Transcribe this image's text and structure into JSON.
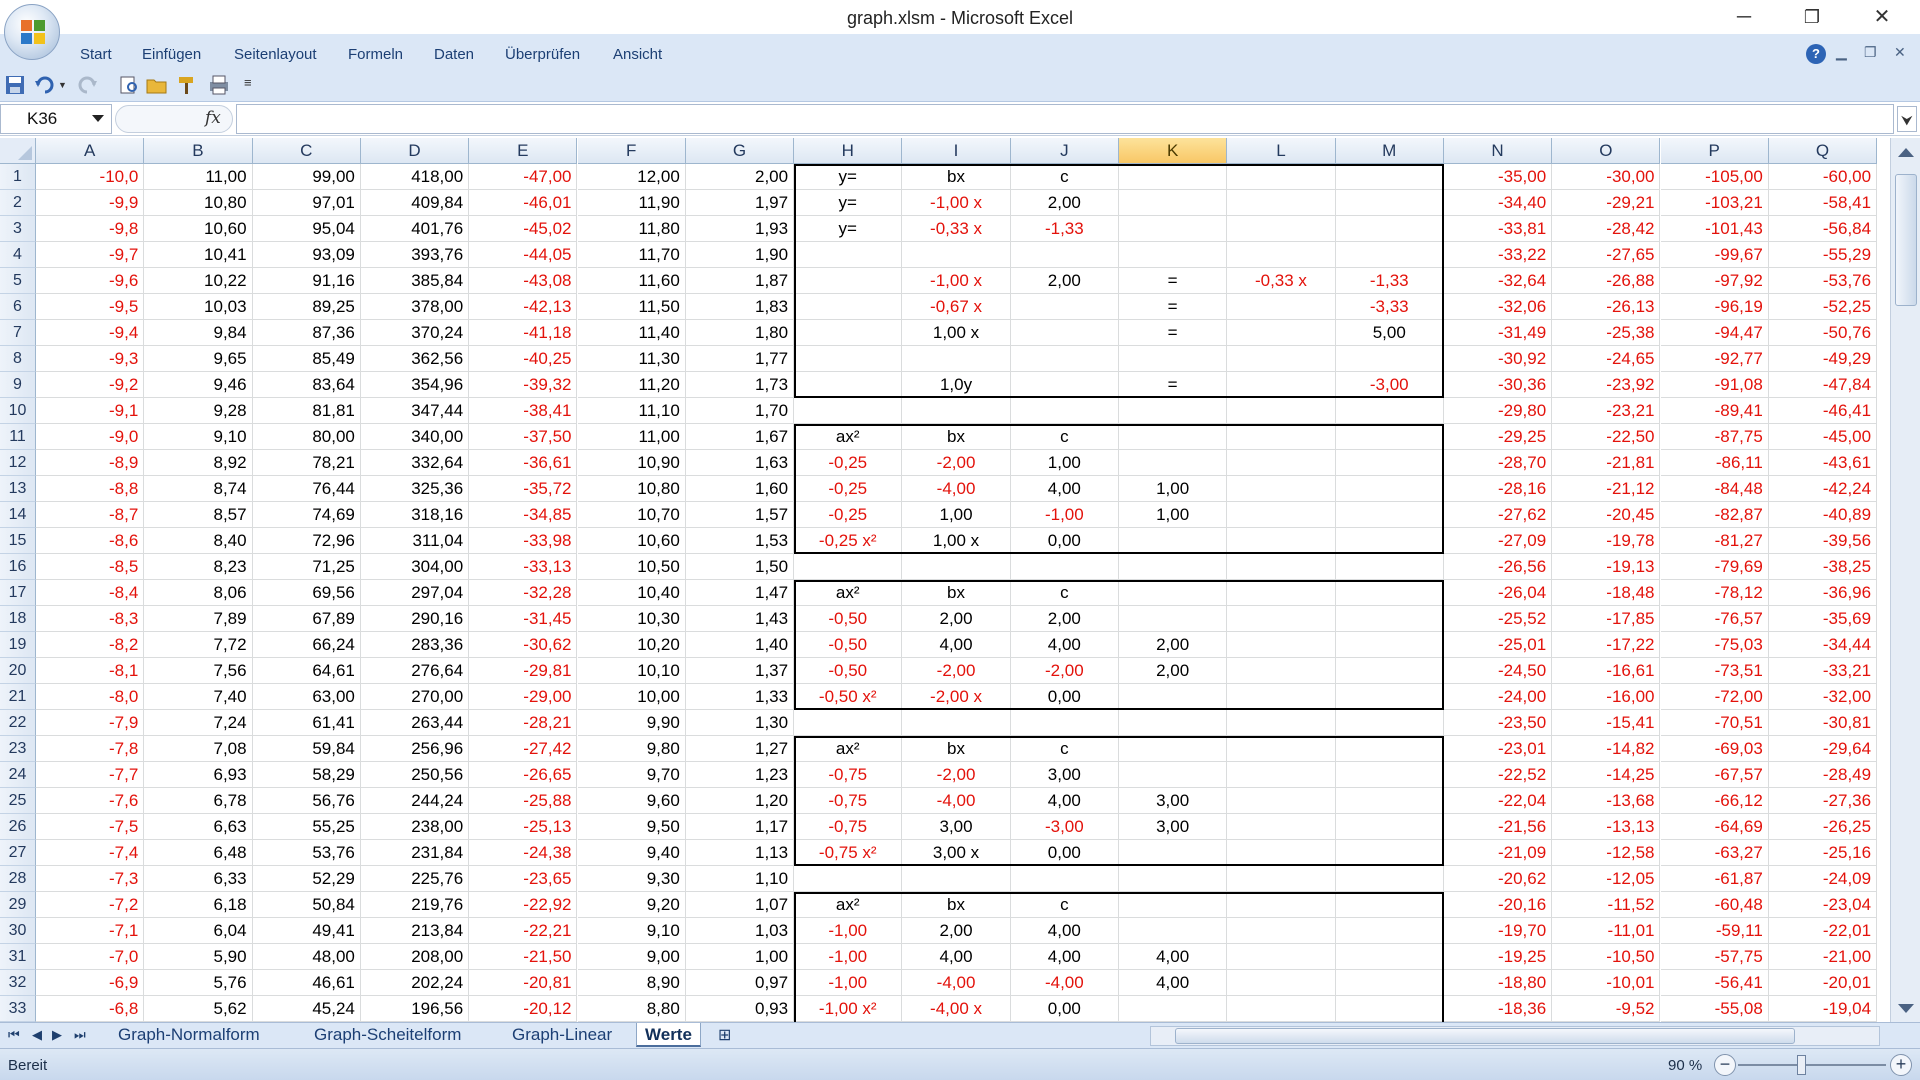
{
  "window": {
    "title": "graph.xlsm - Microsoft Excel",
    "minimize": "─",
    "restore": "❐",
    "close": "✕"
  },
  "ribbon": {
    "tabs": [
      "Start",
      "Einfügen",
      "Seitenlayout",
      "Formeln",
      "Daten",
      "Überprüfen",
      "Ansicht"
    ]
  },
  "formula_bar": {
    "name_box": "K36",
    "fx": "fx",
    "formula": ""
  },
  "columns": [
    "A",
    "B",
    "C",
    "D",
    "E",
    "F",
    "G",
    "H",
    "I",
    "J",
    "K",
    "L",
    "M",
    "N",
    "O",
    "P",
    "Q"
  ],
  "selected_column": "K",
  "rows": [
    [
      "-10,0",
      "11,00",
      "99,00",
      "418,00",
      "-47,00",
      "12,00",
      "2,00",
      "y=",
      "bx",
      "c",
      "",
      "",
      "",
      "-35,00",
      "-30,00",
      "-105,00",
      "-60,00"
    ],
    [
      "-9,9",
      "10,80",
      "97,01",
      "409,84",
      "-46,01",
      "11,90",
      "1,97",
      "y=",
      "-1,00 x",
      "2,00",
      "",
      "",
      "",
      "-34,40",
      "-29,21",
      "-103,21",
      "-58,41"
    ],
    [
      "-9,8",
      "10,60",
      "95,04",
      "401,76",
      "-45,02",
      "11,80",
      "1,93",
      "y=",
      "-0,33 x",
      "-1,33",
      "",
      "",
      "",
      "-33,81",
      "-28,42",
      "-101,43",
      "-56,84"
    ],
    [
      "-9,7",
      "10,41",
      "93,09",
      "393,76",
      "-44,05",
      "11,70",
      "1,90",
      "",
      "",
      "",
      "",
      "",
      "",
      "-33,22",
      "-27,65",
      "-99,67",
      "-55,29"
    ],
    [
      "-9,6",
      "10,22",
      "91,16",
      "385,84",
      "-43,08",
      "11,60",
      "1,87",
      "",
      "-1,00 x",
      "2,00",
      "=",
      "-0,33 x",
      "-1,33",
      "-32,64",
      "-26,88",
      "-97,92",
      "-53,76"
    ],
    [
      "-9,5",
      "10,03",
      "89,25",
      "378,00",
      "-42,13",
      "11,50",
      "1,83",
      "",
      "-0,67 x",
      "",
      "=",
      "",
      "-3,33",
      "-32,06",
      "-26,13",
      "-96,19",
      "-52,25"
    ],
    [
      "-9,4",
      "9,84",
      "87,36",
      "370,24",
      "-41,18",
      "11,40",
      "1,80",
      "",
      "1,00 x",
      "",
      "=",
      "",
      "5,00",
      "-31,49",
      "-25,38",
      "-94,47",
      "-50,76"
    ],
    [
      "-9,3",
      "9,65",
      "85,49",
      "362,56",
      "-40,25",
      "11,30",
      "1,77",
      "",
      "",
      "",
      "",
      "",
      "",
      "-30,92",
      "-24,65",
      "-92,77",
      "-49,29"
    ],
    [
      "-9,2",
      "9,46",
      "83,64",
      "354,96",
      "-39,32",
      "11,20",
      "1,73",
      "",
      "1,0y",
      "",
      "=",
      "",
      "-3,00",
      "-30,36",
      "-23,92",
      "-91,08",
      "-47,84"
    ],
    [
      "-9,1",
      "9,28",
      "81,81",
      "347,44",
      "-38,41",
      "11,10",
      "1,70",
      "",
      "",
      "",
      "",
      "",
      "",
      "-29,80",
      "-23,21",
      "-89,41",
      "-46,41"
    ],
    [
      "-9,0",
      "9,10",
      "80,00",
      "340,00",
      "-37,50",
      "11,00",
      "1,67",
      "ax²",
      "bx",
      "c",
      "",
      "",
      "",
      "-29,25",
      "-22,50",
      "-87,75",
      "-45,00"
    ],
    [
      "-8,9",
      "8,92",
      "78,21",
      "332,64",
      "-36,61",
      "10,90",
      "1,63",
      "-0,25",
      "-2,00",
      "1,00",
      "",
      "",
      "",
      "-28,70",
      "-21,81",
      "-86,11",
      "-43,61"
    ],
    [
      "-8,8",
      "8,74",
      "76,44",
      "325,36",
      "-35,72",
      "10,80",
      "1,60",
      "-0,25",
      "-4,00",
      "4,00",
      "1,00",
      "",
      "",
      "-28,16",
      "-21,12",
      "-84,48",
      "-42,24"
    ],
    [
      "-8,7",
      "8,57",
      "74,69",
      "318,16",
      "-34,85",
      "10,70",
      "1,57",
      "-0,25",
      "1,00",
      "-1,00",
      "1,00",
      "",
      "",
      "-27,62",
      "-20,45",
      "-82,87",
      "-40,89"
    ],
    [
      "-8,6",
      "8,40",
      "72,96",
      "311,04",
      "-33,98",
      "10,60",
      "1,53",
      "-0,25 x²",
      "1,00 x",
      "0,00",
      "",
      "",
      "",
      "-27,09",
      "-19,78",
      "-81,27",
      "-39,56"
    ],
    [
      "-8,5",
      "8,23",
      "71,25",
      "304,00",
      "-33,13",
      "10,50",
      "1,50",
      "",
      "",
      "",
      "",
      "",
      "",
      "-26,56",
      "-19,13",
      "-79,69",
      "-38,25"
    ],
    [
      "-8,4",
      "8,06",
      "69,56",
      "297,04",
      "-32,28",
      "10,40",
      "1,47",
      "ax²",
      "bx",
      "c",
      "",
      "",
      "",
      "-26,04",
      "-18,48",
      "-78,12",
      "-36,96"
    ],
    [
      "-8,3",
      "7,89",
      "67,89",
      "290,16",
      "-31,45",
      "10,30",
      "1,43",
      "-0,50",
      "2,00",
      "2,00",
      "",
      "",
      "",
      "-25,52",
      "-17,85",
      "-76,57",
      "-35,69"
    ],
    [
      "-8,2",
      "7,72",
      "66,24",
      "283,36",
      "-30,62",
      "10,20",
      "1,40",
      "-0,50",
      "4,00",
      "4,00",
      "2,00",
      "",
      "",
      "-25,01",
      "-17,22",
      "-75,03",
      "-34,44"
    ],
    [
      "-8,1",
      "7,56",
      "64,61",
      "276,64",
      "-29,81",
      "10,10",
      "1,37",
      "-0,50",
      "-2,00",
      "-2,00",
      "2,00",
      "",
      "",
      "-24,50",
      "-16,61",
      "-73,51",
      "-33,21"
    ],
    [
      "-8,0",
      "7,40",
      "63,00",
      "270,00",
      "-29,00",
      "10,00",
      "1,33",
      "-0,50 x²",
      "-2,00 x",
      "0,00",
      "",
      "",
      "",
      "-24,00",
      "-16,00",
      "-72,00",
      "-32,00"
    ],
    [
      "-7,9",
      "7,24",
      "61,41",
      "263,44",
      "-28,21",
      "9,90",
      "1,30",
      "",
      "",
      "",
      "",
      "",
      "",
      "-23,50",
      "-15,41",
      "-70,51",
      "-30,81"
    ],
    [
      "-7,8",
      "7,08",
      "59,84",
      "256,96",
      "-27,42",
      "9,80",
      "1,27",
      "ax²",
      "bx",
      "c",
      "",
      "",
      "",
      "-23,01",
      "-14,82",
      "-69,03",
      "-29,64"
    ],
    [
      "-7,7",
      "6,93",
      "58,29",
      "250,56",
      "-26,65",
      "9,70",
      "1,23",
      "-0,75",
      "-2,00",
      "3,00",
      "",
      "",
      "",
      "-22,52",
      "-14,25",
      "-67,57",
      "-28,49"
    ],
    [
      "-7,6",
      "6,78",
      "56,76",
      "244,24",
      "-25,88",
      "9,60",
      "1,20",
      "-0,75",
      "-4,00",
      "4,00",
      "3,00",
      "",
      "",
      "-22,04",
      "-13,68",
      "-66,12",
      "-27,36"
    ],
    [
      "-7,5",
      "6,63",
      "55,25",
      "238,00",
      "-25,13",
      "9,50",
      "1,17",
      "-0,75",
      "3,00",
      "-3,00",
      "3,00",
      "",
      "",
      "-21,56",
      "-13,13",
      "-64,69",
      "-26,25"
    ],
    [
      "-7,4",
      "6,48",
      "53,76",
      "231,84",
      "-24,38",
      "9,40",
      "1,13",
      "-0,75 x²",
      "3,00 x",
      "0,00",
      "",
      "",
      "",
      "-21,09",
      "-12,58",
      "-63,27",
      "-25,16"
    ],
    [
      "-7,3",
      "6,33",
      "52,29",
      "225,76",
      "-23,65",
      "9,30",
      "1,10",
      "",
      "",
      "",
      "",
      "",
      "",
      "-20,62",
      "-12,05",
      "-61,87",
      "-24,09"
    ],
    [
      "-7,2",
      "6,18",
      "50,84",
      "219,76",
      "-22,92",
      "9,20",
      "1,07",
      "ax²",
      "bx",
      "c",
      "",
      "",
      "",
      "-20,16",
      "-11,52",
      "-60,48",
      "-23,04"
    ],
    [
      "-7,1",
      "6,04",
      "49,41",
      "213,84",
      "-22,21",
      "9,10",
      "1,03",
      "-1,00",
      "2,00",
      "4,00",
      "",
      "",
      "",
      "-19,70",
      "-11,01",
      "-59,11",
      "-22,01"
    ],
    [
      "-7,0",
      "5,90",
      "48,00",
      "208,00",
      "-21,50",
      "9,00",
      "1,00",
      "-1,00",
      "4,00",
      "4,00",
      "4,00",
      "",
      "",
      "-19,25",
      "-10,50",
      "-57,75",
      "-21,00"
    ],
    [
      "-6,9",
      "5,76",
      "46,61",
      "202,24",
      "-20,81",
      "8,90",
      "0,97",
      "-1,00",
      "-4,00",
      "-4,00",
      "4,00",
      "",
      "",
      "-18,80",
      "-10,01",
      "-56,41",
      "-20,01"
    ],
    [
      "-6,8",
      "5,62",
      "45,24",
      "196,56",
      "-20,12",
      "8,80",
      "0,93",
      "-1,00 x²",
      "-4,00 x",
      "0,00",
      "",
      "",
      "",
      "-18,36",
      "-9,52",
      "-55,08",
      "-19,04"
    ]
  ],
  "sheets": [
    "Graph-Normalform",
    "Graph-Scheitelform",
    "Graph-Linear",
    "Werte"
  ],
  "active_sheet": "Werte",
  "status": {
    "text": "Bereit",
    "zoom": "90 %"
  },
  "colors": {
    "negative": "#e3120b",
    "selected_header": "#f8c766",
    "ribbon": "#dbe7f6"
  }
}
